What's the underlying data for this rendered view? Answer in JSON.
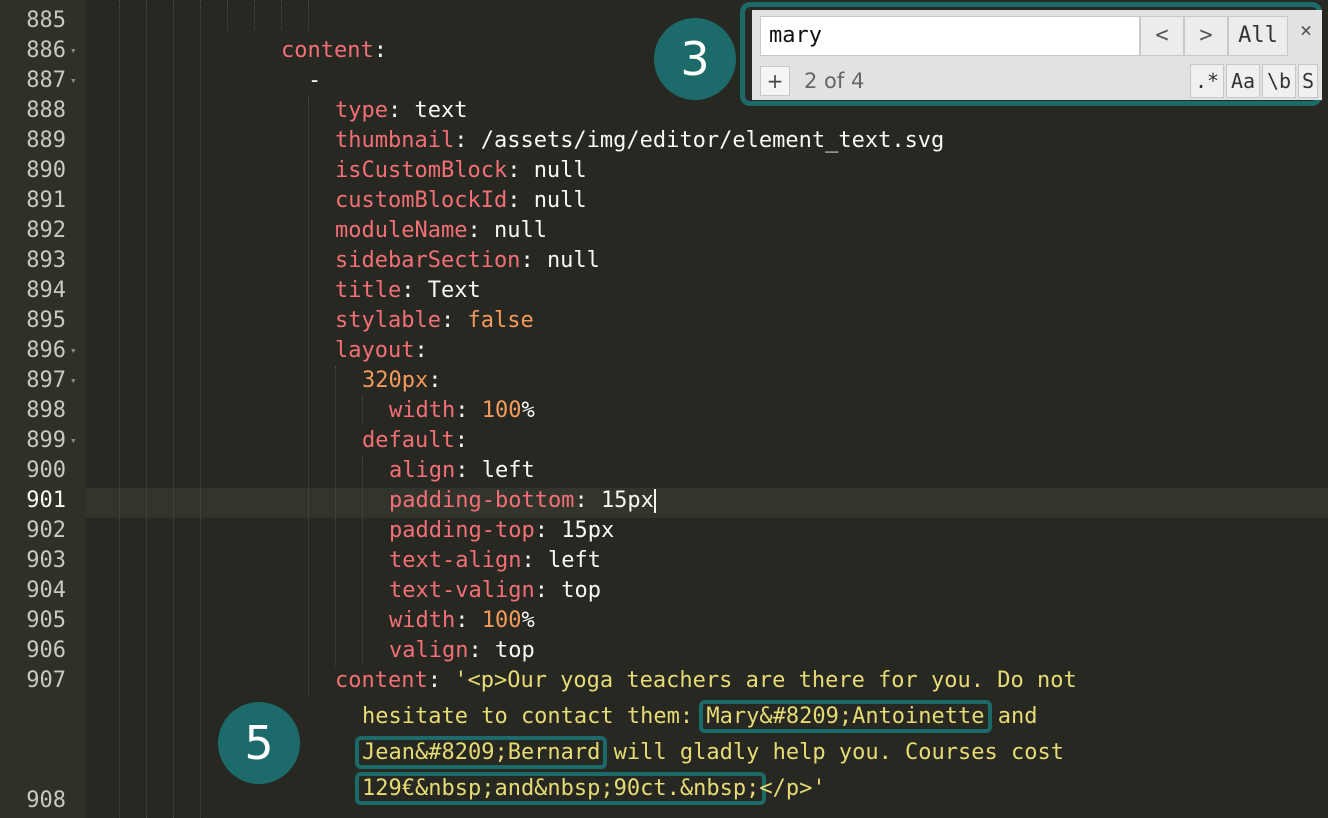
{
  "editor": {
    "active_line": "901",
    "lines": [
      {
        "num": "885"
      },
      {
        "num": "886",
        "fold": true,
        "key": "content",
        "sep": ":"
      },
      {
        "num": "887",
        "fold": true,
        "dash": "-"
      },
      {
        "num": "888",
        "key": "type",
        "sep": ": ",
        "value": "text"
      },
      {
        "num": "889",
        "key": "thumbnail",
        "sep": ": ",
        "value": "/assets/img/editor/element_text.svg"
      },
      {
        "num": "890",
        "key": "isCustomBlock",
        "sep": ": ",
        "value": "null"
      },
      {
        "num": "891",
        "key": "customBlockId",
        "sep": ": ",
        "value": "null"
      },
      {
        "num": "892",
        "key": "moduleName",
        "sep": ": ",
        "value": "null"
      },
      {
        "num": "893",
        "key": "sidebarSection",
        "sep": ": ",
        "value": "null"
      },
      {
        "num": "894",
        "key": "title",
        "sep": ": ",
        "value": "Text"
      },
      {
        "num": "895",
        "key": "stylable",
        "sep": ": ",
        "value": "false"
      },
      {
        "num": "896",
        "fold": true,
        "key": "layout",
        "sep": ":"
      },
      {
        "num": "897",
        "fold": true,
        "key": "320px",
        "sep": ":"
      },
      {
        "num": "898",
        "key": "width",
        "sep": ": ",
        "num_val": "100",
        "unit": "%"
      },
      {
        "num": "899",
        "fold": true,
        "key": "default",
        "sep": ":"
      },
      {
        "num": "900",
        "key": "align",
        "sep": ": ",
        "value": "left"
      },
      {
        "num": "901",
        "key": "padding-bottom",
        "sep": ": ",
        "value": "15px"
      },
      {
        "num": "902",
        "key": "padding-top",
        "sep": ": ",
        "value": "15px"
      },
      {
        "num": "903",
        "key": "text-align",
        "sep": ": ",
        "value": "left"
      },
      {
        "num": "904",
        "key": "text-valign",
        "sep": ": ",
        "value": "top"
      },
      {
        "num": "905",
        "key": "width",
        "sep": ": ",
        "num_val": "100",
        "unit": "%"
      },
      {
        "num": "906",
        "key": "valign",
        "sep": ": ",
        "value": "top"
      },
      {
        "num": "907",
        "key": "content",
        "sep": ": "
      },
      {
        "num": "908"
      }
    ],
    "content_907": {
      "l1": "'<p>Our yoga teachers are there for you. Do not",
      "l2a": "hesitate to contact them: ",
      "l2_match": "Mary&#8209;Antoinette",
      "l2b": " and",
      "l3_match": "Jean&#8209;Bernard",
      "l3b": " will gladly help you. Courses cost",
      "l4_match": "129€&nbsp;and&nbsp;90ct.&nbsp;",
      "l4b": "</p>'"
    }
  },
  "find_panel": {
    "query": "mary",
    "prev_glyph": "<",
    "next_glyph": ">",
    "all_label": "All",
    "close_glyph": "×",
    "add_glyph": "+",
    "count": "2 of 4",
    "opt_regex": ".*",
    "opt_case": "Aa",
    "opt_word": "\\b",
    "opt_selection": "S"
  },
  "badges": {
    "find_badge": "3",
    "content_badge": "5"
  },
  "colors": {
    "accent": "#1d6a6a",
    "background": "#272822",
    "key": "#f26f76",
    "string": "#e6db74",
    "number": "#f39a5c"
  }
}
